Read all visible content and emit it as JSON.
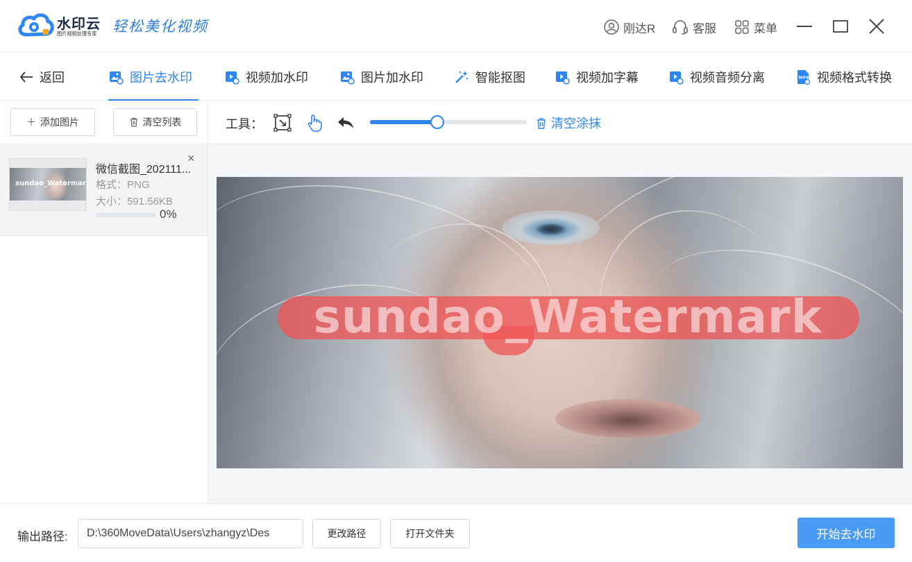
{
  "titlebar": {
    "brand_name": "水印云",
    "brand_sub": "图片视频处理专家",
    "slogan": "轻松美化视频",
    "user_label": "刚达R",
    "service_label": "客服",
    "menu_label": "菜单"
  },
  "nav": {
    "back_label": "返回",
    "tabs": [
      {
        "label": "图片去水印",
        "icon": "image-icon",
        "active": true
      },
      {
        "label": "视频加水印",
        "icon": "video-icon"
      },
      {
        "label": "图片加水印",
        "icon": "image-icon"
      },
      {
        "label": "智能抠图",
        "icon": "magic-wand-icon"
      },
      {
        "label": "视频加字幕",
        "icon": "video-icon"
      },
      {
        "label": "视频音频分离",
        "icon": "video-icon"
      },
      {
        "label": "视频格式转换",
        "icon": "mp4-file-icon"
      }
    ]
  },
  "left": {
    "add_label": "添加图片",
    "clear_list_label": "清空列表",
    "file": {
      "name": "微信截图_202111...",
      "format": "格式：PNG",
      "size": "大小：591.56KB",
      "progress_fraction": 0.0,
      "progress_text": "0%",
      "thumb_watermark": "sundao_Watermark"
    }
  },
  "tools": {
    "label": "工具：",
    "brush_size_fraction": 0.43,
    "clear_smear_label": "清空涂抹"
  },
  "canvas": {
    "watermark_text": "sundao_Watermark"
  },
  "bottom": {
    "output_label": "输出路径:",
    "output_path": "D:\\360MoveData\\Users\\zhangyz\\Des",
    "change_path_label": "更改路径",
    "open_folder_label": "打开文件夹",
    "start_label": "开始去水印"
  },
  "colors": {
    "accent": "#2e85f4",
    "primary_button": "#4a9bf6",
    "mask": "#ee5656"
  }
}
